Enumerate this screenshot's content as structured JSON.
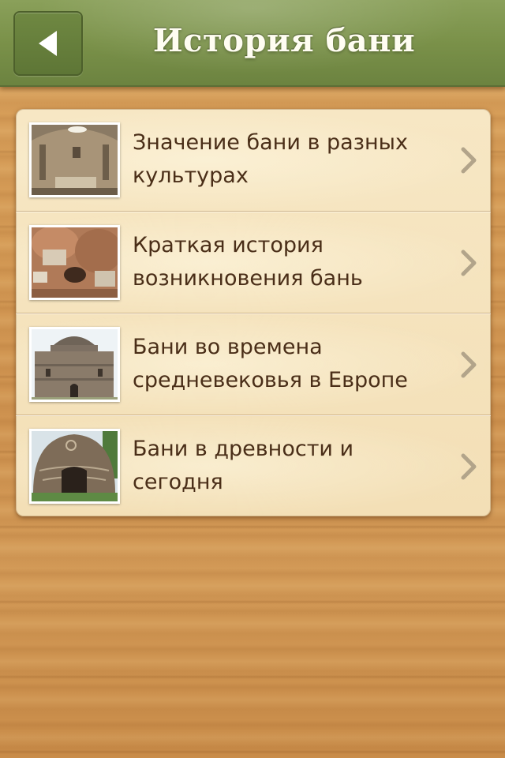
{
  "header": {
    "title": "История бани",
    "back_icon": "back-arrow-icon"
  },
  "list": {
    "items": [
      {
        "label": "Значение бани в разных\nкультурах",
        "thumb": "roman-bath-interior-photo"
      },
      {
        "label": "Краткая история\nвозникновения бань",
        "thumb": "ancient-bath-ruins-photo"
      },
      {
        "label": "Бани во времена\nсредневековья в Европе",
        "thumb": "domed-stone-bathhouse-photo"
      },
      {
        "label": "Бани в древности и\nсегодня",
        "thumb": "domed-clay-bathhouse-photo"
      }
    ],
    "chevron_icon": "chevron-right-icon"
  },
  "colors": {
    "header_green": "#7a9149",
    "card": "#f5e3bd",
    "text": "#4a2e18",
    "wood": "#d49a55"
  }
}
